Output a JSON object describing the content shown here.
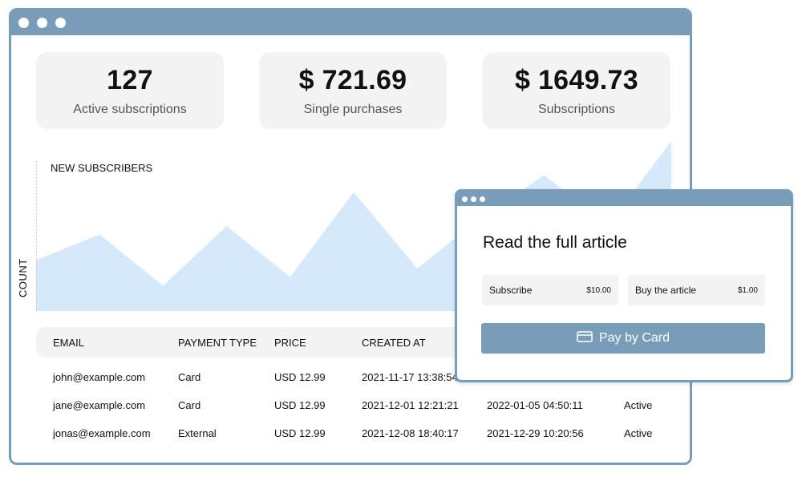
{
  "stats": [
    {
      "value": "127",
      "label": "Active subscriptions"
    },
    {
      "value": "$ 721.69",
      "label": "Single purchases"
    },
    {
      "value": "$ 1649.73",
      "label": "Subscriptions"
    }
  ],
  "chart_data": {
    "type": "area",
    "title": "NEW SUBSCRIBERS",
    "xlabel": "",
    "ylabel": "COUNT",
    "values": [
      6,
      9,
      3,
      10,
      4,
      14,
      5,
      11,
      16,
      10,
      20
    ],
    "ylim": [
      0,
      20
    ],
    "grid": false,
    "color": "#d6e9fb"
  },
  "table": {
    "columns": [
      "EMAIL",
      "PAYMENT TYPE",
      "PRICE",
      "CREATED AT"
    ],
    "rows": [
      [
        "john@example.com",
        "Card",
        "USD 12.99",
        "2021-11-17 13:38:54",
        "",
        ""
      ],
      [
        "jane@example.com",
        "Card",
        "USD 12.99",
        "2021-12-01 12:21:21",
        "2022-01-05 04:50:11",
        "Active"
      ],
      [
        "jonas@example.com",
        "External",
        "USD 12.99",
        "2021-12-08 18:40:17",
        "2021-12-29 10:20:56",
        "Active"
      ]
    ]
  },
  "popup": {
    "title": "Read the full article",
    "options": [
      {
        "label": "Subscribe",
        "price": "$10.00"
      },
      {
        "label": "Buy the article",
        "price": "$1.00"
      }
    ],
    "pay_label": "Pay by Card"
  },
  "colors": {
    "accent": "#799db8",
    "card": "#f3f3f3",
    "chart_fill": "#d6e9fb"
  }
}
